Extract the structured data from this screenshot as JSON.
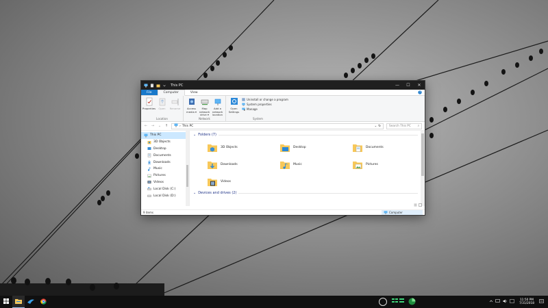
{
  "window": {
    "title": "This PC",
    "minimize": "—",
    "maximize": "☐",
    "close": "✕"
  },
  "ribbon_tabs": [
    {
      "label": "File"
    },
    {
      "label": "Computer"
    },
    {
      "label": "View"
    }
  ],
  "ribbon": {
    "location": {
      "label": "Location",
      "buttons": [
        {
          "label": "Properties"
        },
        {
          "label": "Open"
        },
        {
          "label": "Rename"
        }
      ]
    },
    "network": {
      "label": "Network",
      "buttons": [
        {
          "label": "Access media ▾"
        },
        {
          "label": "Map network drive ▾"
        },
        {
          "label": "Add a network location"
        }
      ]
    },
    "system": {
      "label": "System",
      "open_settings": "Open Settings",
      "items": [
        {
          "label": "Uninstall or change a program"
        },
        {
          "label": "System properties"
        },
        {
          "label": "Manage"
        }
      ]
    }
  },
  "address": {
    "back": "←",
    "forward": "→",
    "recent": "⌄",
    "up": "↑",
    "path": "This PC",
    "separator": "›",
    "dropdown": "⌄",
    "refresh": "↻",
    "search_placeholder": "Search This PC",
    "search_glyph": "⌕"
  },
  "nav_pane": {
    "items": [
      {
        "label": "This PC"
      },
      {
        "label": "3D Objects"
      },
      {
        "label": "Desktop"
      },
      {
        "label": "Documents"
      },
      {
        "label": "Downloads"
      },
      {
        "label": "Music"
      },
      {
        "label": "Pictures"
      },
      {
        "label": "Videos"
      },
      {
        "label": "Local Disk (C:)"
      },
      {
        "label": "Local Disk (D:)"
      }
    ]
  },
  "content": {
    "folders_header": "Folders (7)",
    "folders": [
      {
        "label": "3D Objects"
      },
      {
        "label": "Desktop"
      },
      {
        "label": "Documents"
      },
      {
        "label": "Downloads"
      },
      {
        "label": "Music"
      },
      {
        "label": "Pictures"
      },
      {
        "label": "Videos"
      }
    ],
    "devices_header": "Devices and drives (2)",
    "chevron": "⌄"
  },
  "status": {
    "items_count": "9 items",
    "computer_label": "Computer"
  },
  "taskbar": {
    "time": "11:50 PM",
    "date": "7/31/2018"
  },
  "colors": {
    "file_tab": "#1979ca",
    "selection": "#cce8ff",
    "folder_yellow": "#f7c85a",
    "accent_blue": "#2b88d8",
    "taskbar": "#101010"
  }
}
